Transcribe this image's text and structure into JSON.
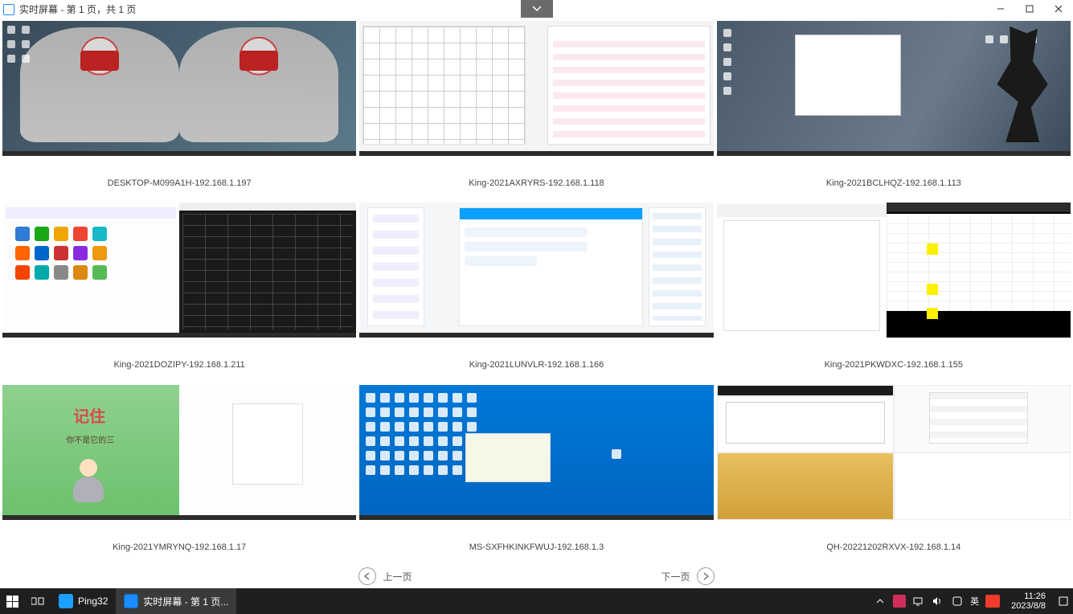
{
  "window": {
    "title": "实时屏幕 - 第 1 页，共 1 页"
  },
  "screens": [
    {
      "label": "DESKTOP-M099A1H-192.168.1.197"
    },
    {
      "label": "King-2021AXRYRS-192.168.1.118"
    },
    {
      "label": "King-2021BCLHQZ-192.168.1.113"
    },
    {
      "label": "King-2021DOZIPY-192.168.1.211"
    },
    {
      "label": "King-2021LUNVLR-192.168.1.166"
    },
    {
      "label": "King-2021PKWDXC-192.168.1.155"
    },
    {
      "label": "King-2021YMRYNQ-192.168.1.17"
    },
    {
      "label": "MS-SXFHKINKFWUJ-192.168.1.3"
    },
    {
      "label": "QH-20221202RXVX-192.168.1.14"
    }
  ],
  "thumb7": {
    "poster_title": "记住",
    "poster_sub": "你不是它的三"
  },
  "pager": {
    "prev": "上一页",
    "next": "下一页"
  },
  "taskbar": {
    "app_ping": "Ping32",
    "app_active": "实时屏幕 - 第 1 页...",
    "ime": "英",
    "time": "11:26",
    "date": "2023/8/8"
  }
}
